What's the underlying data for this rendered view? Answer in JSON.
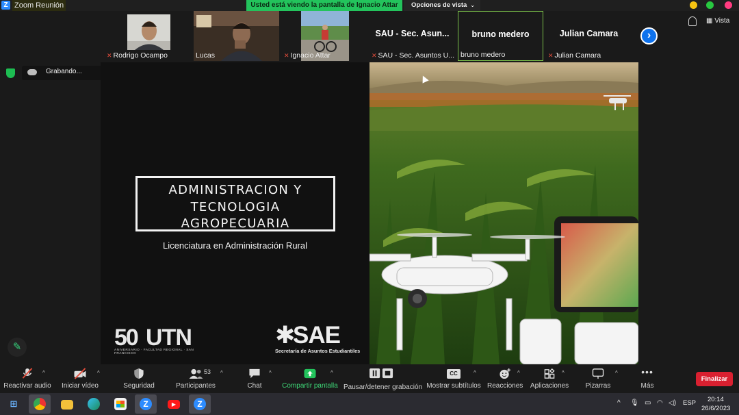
{
  "window": {
    "title": "Zoom Reunión",
    "logo_letter": "Z",
    "share_banner": "Usted está viendo la pantalla de Ignacio Attar",
    "view_options_label": "Opciones de vista",
    "traffic_colors": [
      "#f5c211",
      "#28c840",
      "#ff3b80"
    ]
  },
  "gallery": {
    "participants": [
      {
        "name": "Rodrigo Ocampo",
        "muted": true,
        "video": true
      },
      {
        "name": "Lucas",
        "muted": false,
        "video": true
      },
      {
        "name": "Ignacio Attar",
        "muted": true,
        "video": true
      },
      {
        "name": "SAU - Sec. Asuntos U...",
        "display": "SAU - Sec. Asun...",
        "muted": true,
        "video": false
      },
      {
        "name": "bruno medero",
        "display": "bruno medero",
        "muted": false,
        "video": false,
        "active_speaker": true
      },
      {
        "name": "Julian Camara",
        "display": "Julian Camara",
        "muted": true,
        "video": false
      }
    ],
    "next_icon": "chevron-right-icon",
    "vista_label": "Vista"
  },
  "recording": {
    "label": "Grabando...",
    "pause_glyph": "❚❚"
  },
  "slide": {
    "title_lines": [
      "ADMINISTRACION Y",
      "TECNOLOGIA",
      "AGROPECUARIA"
    ],
    "subtitle": "Licenciatura en Administración Rural",
    "utn": {
      "number": "50",
      "word": "UTN",
      "tagline": "ANIVERSARIO · FACULTAD REGIONAL · SAN FRANCISCO"
    },
    "sae": {
      "word": "SAE",
      "star": "✱",
      "tagline": "Secretaría de Asuntos Estudiantiles"
    }
  },
  "toolbar": {
    "participants_count": "53",
    "buttons": [
      {
        "id": "audio",
        "label": "Reactivar audio"
      },
      {
        "id": "video",
        "label": "Iniciar vídeo"
      },
      {
        "id": "security",
        "label": "Seguridad"
      },
      {
        "id": "participants",
        "label": "Participantes"
      },
      {
        "id": "chat",
        "label": "Chat"
      },
      {
        "id": "share",
        "label": "Compartir pantalla"
      },
      {
        "id": "pause-recording",
        "label": "Pausar/detener grabación"
      },
      {
        "id": "subtitles",
        "label": "Mostrar subtítulos"
      },
      {
        "id": "reactions",
        "label": "Reacciones"
      },
      {
        "id": "apps",
        "label": "Aplicaciones"
      },
      {
        "id": "whiteboards",
        "label": "Pizarras"
      },
      {
        "id": "more",
        "label": "Más"
      }
    ],
    "cc_glyph": "CC",
    "end_label": "Finalizar"
  },
  "taskbar": {
    "apps": [
      "start",
      "chrome",
      "file-explorer",
      "edge",
      "store",
      "zoom",
      "youtube",
      "zoom-meetings"
    ],
    "language": "ESP",
    "time": "20:14",
    "date": "26/6/2023"
  },
  "colors": {
    "accent_green": "#23c35c",
    "zoom_blue": "#0e72ed",
    "end_red": "#d92030",
    "mute_red": "#e04c3b"
  }
}
